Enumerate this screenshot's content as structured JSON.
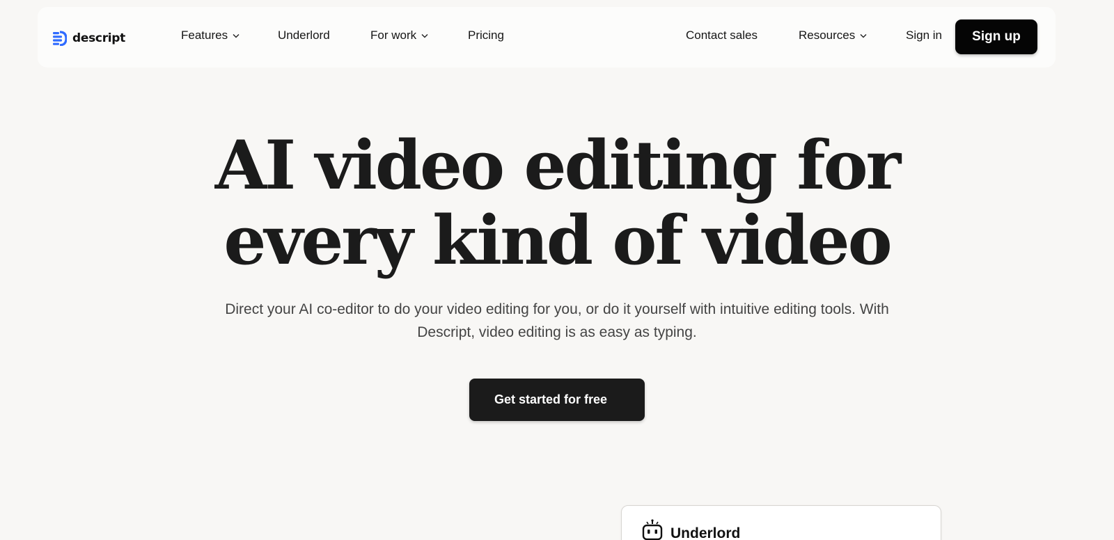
{
  "brand": {
    "name": "descript",
    "accent_color": "#2f6bff"
  },
  "nav": {
    "links": [
      {
        "label": "Features",
        "has_dropdown": true
      },
      {
        "label": "Underlord",
        "has_dropdown": false
      },
      {
        "label": "For work",
        "has_dropdown": true
      },
      {
        "label": "Pricing",
        "has_dropdown": false
      }
    ],
    "right_links": [
      {
        "label": "Contact sales",
        "has_dropdown": false
      },
      {
        "label": "Resources",
        "has_dropdown": true
      },
      {
        "label": "Sign in",
        "has_dropdown": false
      }
    ],
    "signup_label": "Sign up"
  },
  "hero": {
    "title_line1": "AI video editing for",
    "title_line2": "every kind of video",
    "subtitle": "Direct your AI co-editor to do your video editing for you, or do it yourself with intuitive editing tools. With Descript, video editing is as easy as typing.",
    "cta_label": "Get started for free"
  },
  "preview_card": {
    "title": "Underlord",
    "icon": "robot-icon"
  }
}
